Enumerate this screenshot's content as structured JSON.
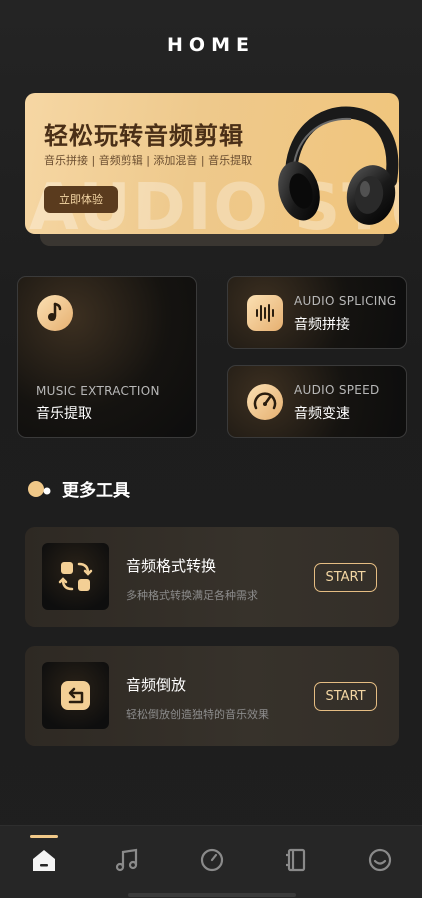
{
  "header": {
    "title": "HOME"
  },
  "banner": {
    "title": "轻松玩转音频剪辑",
    "subtitle": "音乐拼接 | 音频剪辑 | 添加混音 | 音乐提取",
    "button_label": "立即体验",
    "background_text": "AUDIO STUDIO",
    "image": "headphones-image"
  },
  "feature_cards": [
    {
      "en": "MUSIC EXTRACTION",
      "cn": "音乐提取",
      "icon": "music-note-icon"
    },
    {
      "en": "AUDIO SPLICING",
      "cn": "音频拼接",
      "icon": "waveform-icon"
    },
    {
      "en": "AUDIO SPEED",
      "cn": "音频变速",
      "icon": "speedometer-icon"
    }
  ],
  "more_tools": {
    "title": "更多工具",
    "items": [
      {
        "name": "音频格式转换",
        "desc": "多种格式转换满足各种需求",
        "button": "START",
        "icon": "format-convert-icon"
      },
      {
        "name": "音频倒放",
        "desc": "轻松倒放创造独特的音乐效果",
        "button": "START",
        "icon": "reverse-icon"
      }
    ]
  },
  "bottom_nav": {
    "items": [
      {
        "name": "home",
        "icon": "home-icon",
        "active": true
      },
      {
        "name": "music",
        "icon": "music-note-icon",
        "active": false
      },
      {
        "name": "speed",
        "icon": "gauge-icon",
        "active": false
      },
      {
        "name": "notebook",
        "icon": "notebook-icon",
        "active": false
      },
      {
        "name": "profile",
        "icon": "smiley-icon",
        "active": false
      }
    ]
  },
  "colors": {
    "accent": "#f0c888",
    "banner": "#f1cf97",
    "background": "#1d1d1d"
  }
}
